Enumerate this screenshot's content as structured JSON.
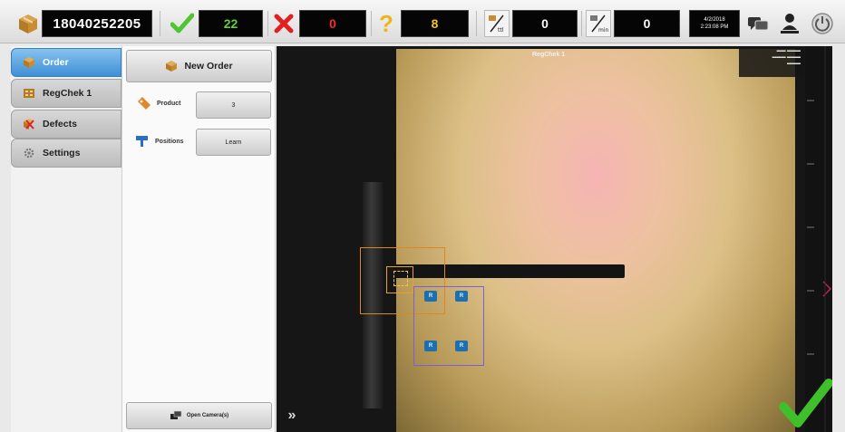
{
  "header": {
    "order_number": "18040252205",
    "pass_count": "22",
    "fail_count": "0",
    "unknown_count": "8",
    "counter_a": "0",
    "counter_b": "0",
    "date": "4/2/2018",
    "time": "2:23:08 PM",
    "colors": {
      "pass": "#5fd13a",
      "fail": "#ff2a2a",
      "unknown": "#f4c11e"
    }
  },
  "sidebar": {
    "items": [
      {
        "label": "Order",
        "icon": "box-icon",
        "active": true
      },
      {
        "label": "RegChek 1",
        "icon": "regchek-icon",
        "active": false
      },
      {
        "label": "Defects",
        "icon": "defects-icon",
        "active": false
      },
      {
        "label": "Settings",
        "icon": "gear-icon",
        "active": false
      }
    ]
  },
  "panel": {
    "new_order_label": "New Order",
    "product_label": "Product",
    "product_value": "3",
    "positions_label": "Positions",
    "learn_label": "Learn",
    "open_camera_label": "Open Camera(s)"
  },
  "camera": {
    "title": "RegChek 1",
    "fiducials": [
      "R",
      "R",
      "R",
      "R"
    ],
    "expand_label": "»",
    "status": "pass"
  }
}
